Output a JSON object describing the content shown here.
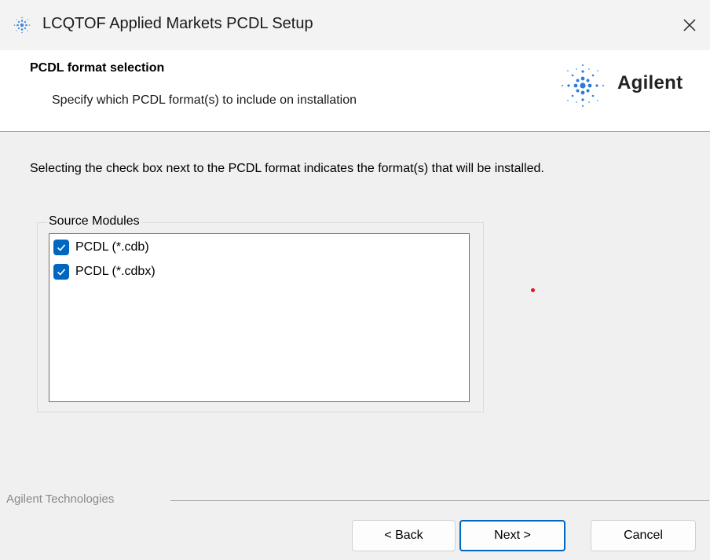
{
  "window": {
    "title": "LCQTOF Applied Markets PCDL Setup",
    "icon": "agilent-spark-icon",
    "close_icon": "close-icon"
  },
  "header": {
    "title": "PCDL format selection",
    "subtitle": "Specify which PCDL format(s) to include on installation",
    "logo_text": "Agilent",
    "logo_icon": "agilent-spark-logo-icon"
  },
  "main": {
    "instruction": "Selecting the check box next to the PCDL format indicates the format(s) that will be installed.",
    "group": {
      "label": "Source Modules",
      "items": [
        {
          "label": "PCDL (*.cdb)",
          "checked": true
        },
        {
          "label": "PCDL (*.cdbx)",
          "checked": true
        }
      ]
    }
  },
  "footer": {
    "brand": "Agilent Technologies",
    "buttons": {
      "back": "< Back",
      "next": "Next >",
      "cancel": "Cancel"
    }
  },
  "colors": {
    "accent": "#0067c0",
    "spark_blue": "#2e7bd6",
    "marker_red": "#e81123"
  }
}
